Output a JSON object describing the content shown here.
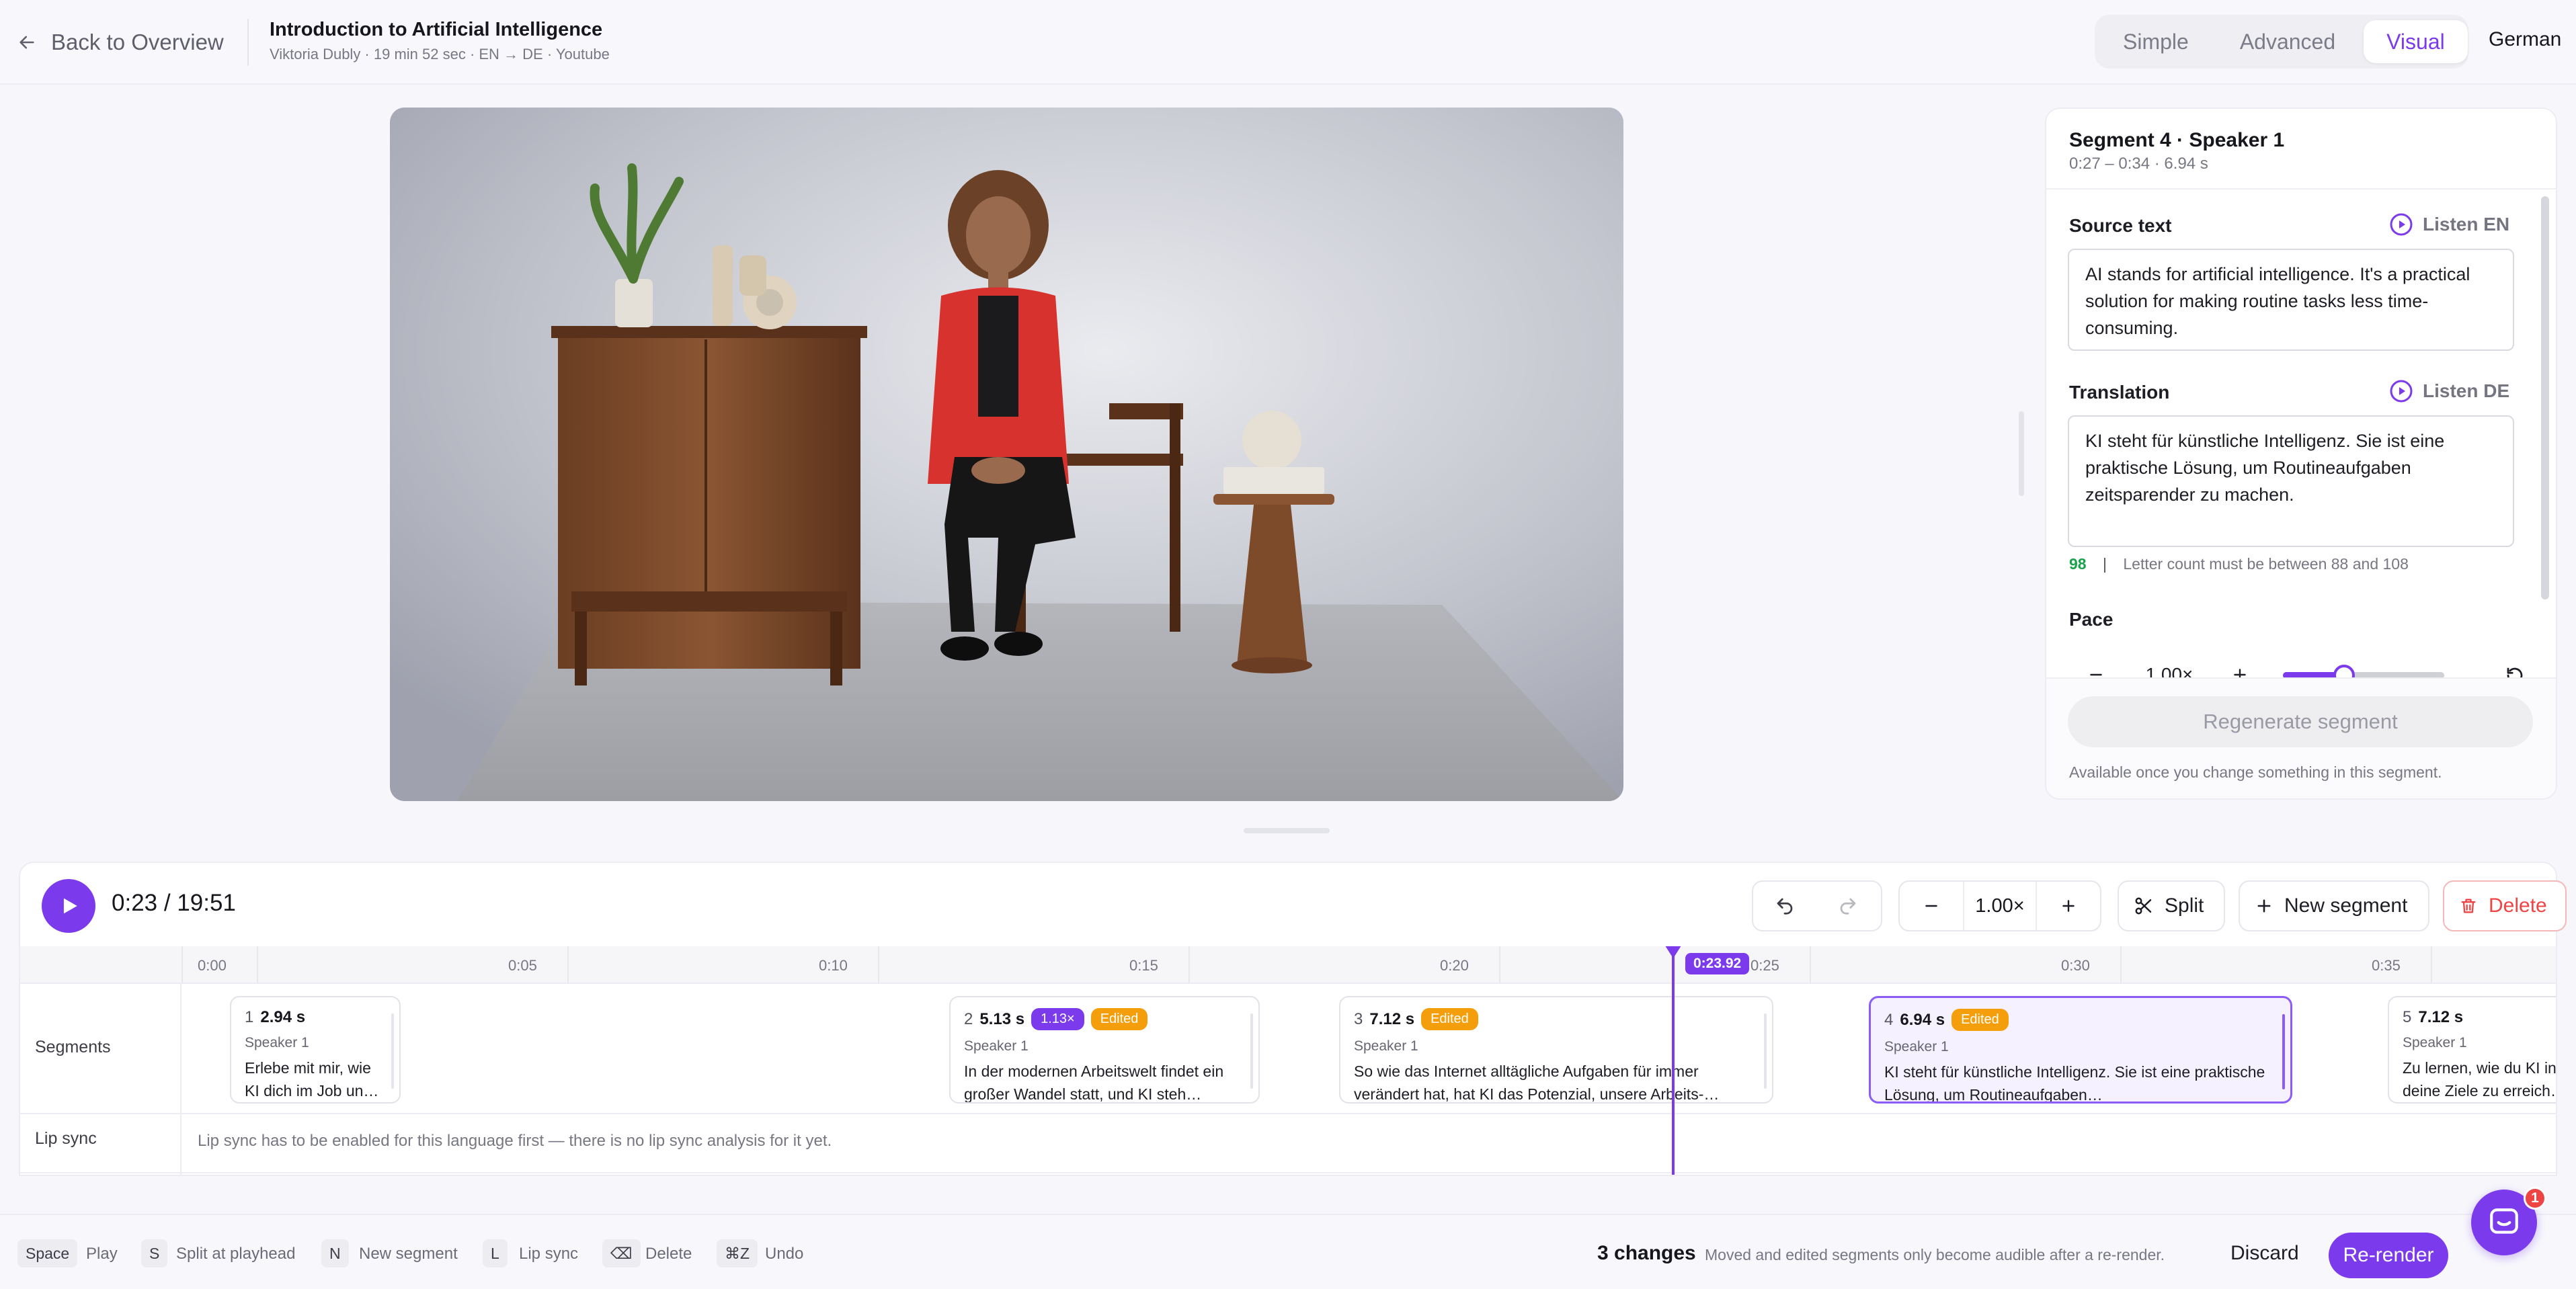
{
  "header": {
    "back_label": "Back to Overview",
    "title": "Introduction to Artificial Intelligence",
    "subtitle": "Viktoria Dubly · 19 min 52 sec · EN → DE · Youtube",
    "modes": [
      "Simple",
      "Advanced",
      "Visual"
    ],
    "active_mode": "Visual",
    "language": "German"
  },
  "panel": {
    "segment_title": "Segment 4 · Speaker 1",
    "segment_range": "0:27 – 0:34 · 6.94 s",
    "source_label": "Source text",
    "listen_source": "Listen EN",
    "source_text": "AI stands for artificial intelligence. It's a practical solution for making routine tasks less time-consuming.",
    "translation_label": "Translation",
    "listen_translation": "Listen DE",
    "translation_text": "KI steht für künstliche Intelligenz. Sie ist eine praktische Lösung, um Routineaufgaben zeitsparender zu machen.",
    "letter_count": "98",
    "letter_separator": "|",
    "letter_hint": "Letter count must be between 88 and 108",
    "pace_label": "Pace",
    "pace_value": "1.00×",
    "pace_level": 0.38,
    "regenerate_label": "Regenerate segment",
    "regenerate_hint": "Available once you change something in this segment."
  },
  "player": {
    "time": "0:23 / 19:51",
    "zoom": "1.00×",
    "split_label": "Split",
    "new_segment_label": "New segment",
    "delete_label": "Delete"
  },
  "timeline": {
    "ticks": [
      "0:00",
      "0:05",
      "0:10",
      "0:15",
      "0:20",
      "0:25",
      "0:30",
      "0:35"
    ],
    "playhead_label": "0:23.92",
    "row_segments_label": "Segments",
    "row_lipsync_label": "Lip sync",
    "lipsync_message": "Lip sync has to be enabled for this language first — there is no lip sync analysis for it yet.",
    "segments": [
      {
        "num": "1",
        "duration": "2.94 s",
        "speaker": "Speaker 1",
        "text": "Erlebe mit mir, wie KI dich im Job un…",
        "badges": []
      },
      {
        "num": "2",
        "duration": "5.13 s",
        "speaker": "Speaker 1",
        "text": "In der modernen Arbeitswelt findet ein großer Wandel statt, und KI steh…",
        "badges": [
          "1.13×",
          "Edited"
        ]
      },
      {
        "num": "3",
        "duration": "7.12 s",
        "speaker": "Speaker 1",
        "text": "So wie das Internet alltägliche Aufgaben für immer verändert hat, hat KI das Potenzial, unsere Arbeits-…",
        "badges": [
          "Edited"
        ]
      },
      {
        "num": "4",
        "duration": "6.94 s",
        "speaker": "Speaker 1",
        "text": "KI steht für künstliche Intelligenz. Sie ist eine praktische Lösung, um Routineaufgaben…",
        "badges": [
          "Edited"
        ]
      },
      {
        "num": "5",
        "duration": "7.12 s",
        "speaker": "Speaker 1",
        "text": "Zu lernen, wie du KI in deine Ziele zu erreich…",
        "badges": []
      }
    ]
  },
  "footer": {
    "shortcuts": [
      {
        "key": "Space",
        "label": "Play"
      },
      {
        "key": "S",
        "label": "Split at playhead"
      },
      {
        "key": "N",
        "label": "New segment"
      },
      {
        "key": "L",
        "label": "Lip sync"
      },
      {
        "key": "⌫",
        "label": "Delete"
      },
      {
        "key": "⌘Z",
        "label": "Undo"
      }
    ],
    "changes": "3 changes",
    "changes_hint": "Moved and edited segments only become audible after a re-render.",
    "discard_label": "Discard",
    "rerender_label": "Re-render"
  },
  "chat": {
    "badge": "1"
  },
  "colors": {
    "accent": "#7c3aed",
    "edited": "#f59e0b",
    "success": "#16a34a",
    "danger": "#ef4444"
  },
  "icons": [
    "arrow-left-icon",
    "play-icon",
    "undo-icon",
    "redo-icon",
    "minus-icon",
    "plus-icon",
    "scissors-icon",
    "trash-icon",
    "reset-icon",
    "chat-icon"
  ]
}
